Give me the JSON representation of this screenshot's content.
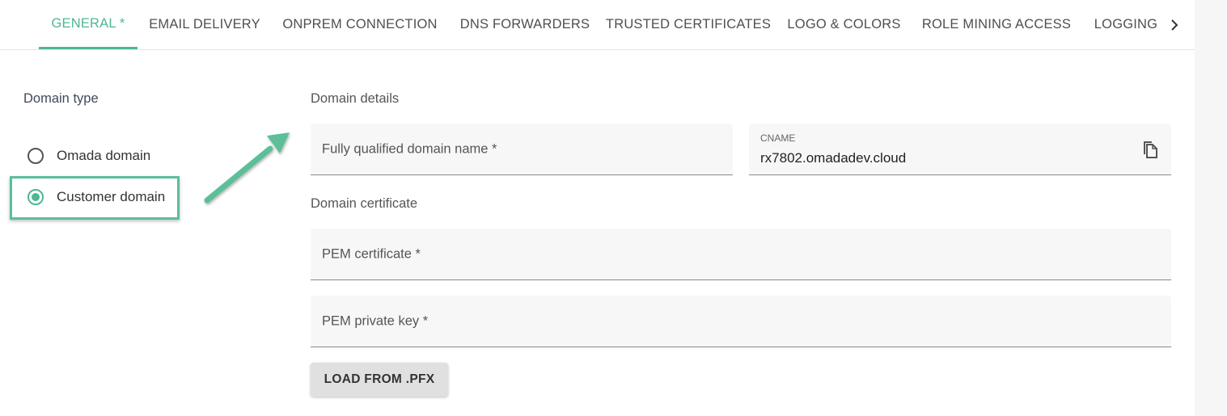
{
  "tabs": [
    {
      "label": "GENERAL *",
      "active": true
    },
    {
      "label": "EMAIL DELIVERY",
      "active": false
    },
    {
      "label": "ONPREM CONNECTION",
      "active": false
    },
    {
      "label": "DNS FORWARDERS",
      "active": false
    },
    {
      "label": "TRUSTED CERTIFICATES",
      "active": false
    },
    {
      "label": "LOGO & COLORS",
      "active": false
    },
    {
      "label": "ROLE MINING ACCESS",
      "active": false
    },
    {
      "label": "LOGGING",
      "active": false
    }
  ],
  "domain_type": {
    "label": "Domain type",
    "options": [
      {
        "label": "Omada domain",
        "selected": false
      },
      {
        "label": "Customer domain",
        "selected": true
      }
    ]
  },
  "domain_details": {
    "label": "Domain details",
    "fqdn": {
      "placeholder": "Fully qualified domain name *",
      "value": ""
    },
    "cname": {
      "label": "CNAME",
      "value": "rx7802.omadadev.cloud"
    }
  },
  "domain_certificate": {
    "label": "Domain certificate",
    "pem_certificate": {
      "placeholder": "PEM certificate *",
      "value": ""
    },
    "pem_private_key": {
      "placeholder": "PEM private key *",
      "value": ""
    },
    "load_button": "LOAD FROM .PFX"
  },
  "colors": {
    "accent": "#4db891",
    "highlight": "#5bbf98"
  }
}
